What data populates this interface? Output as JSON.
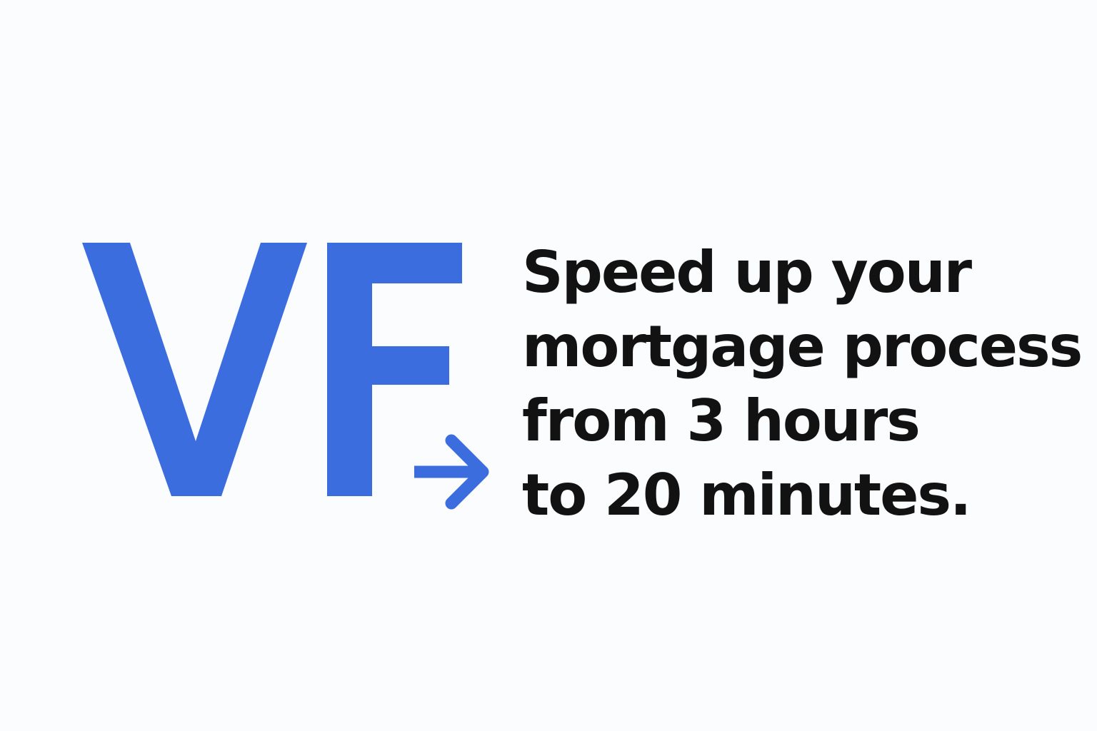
{
  "logo": {
    "letters": "VF",
    "color": "#3b6ddf",
    "arrow_icon": "arrow-right-icon"
  },
  "tagline": {
    "lines": [
      "Speed up your",
      "mortgage process",
      "from 3 hours",
      "to 20 minutes."
    ],
    "color": "#121212"
  },
  "background_color": "#fbfcfe"
}
